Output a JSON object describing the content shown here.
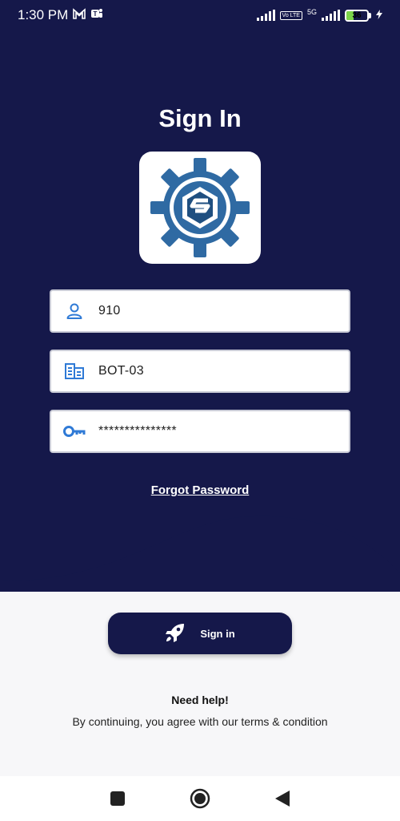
{
  "status_bar": {
    "time": "1:30 PM",
    "icons": [
      "gmail-icon",
      "teams-icon"
    ],
    "network_label": "5G",
    "volte_label": "Vo LTE",
    "battery_percent": 36
  },
  "title": "Sign In",
  "logo": {
    "icon": "gear-e-logo-icon",
    "colors": {
      "primary": "#2f6aa3",
      "dark": "#1f4f80"
    }
  },
  "form": {
    "user_field": {
      "icon": "person-icon",
      "value": "910"
    },
    "company_field": {
      "icon": "building-icon",
      "value": "BOT-03"
    },
    "password_field": {
      "icon": "key-icon",
      "value": "***************"
    }
  },
  "forgot_password": "Forgot Password",
  "sign_in_button": {
    "icon": "rocket-icon",
    "label": "Sign in"
  },
  "help": {
    "title": "Need help!",
    "text": "By continuing, you agree with our terms & condition"
  },
  "nav": {
    "icons": [
      "recents-square-icon",
      "home-circle-icon",
      "back-triangle-icon"
    ]
  },
  "colors": {
    "primary": "#15184a",
    "accent_icon": "#2f7ad6",
    "background": "#f7f7f9"
  }
}
